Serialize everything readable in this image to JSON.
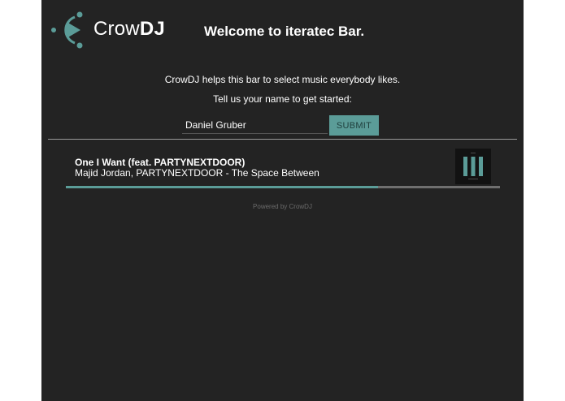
{
  "brand": {
    "name_regular": "Crow",
    "name_bold": "DJ"
  },
  "welcome": {
    "title": "Welcome to iteratec Bar.",
    "line1": "CrowDJ helps this bar to select music everybody likes.",
    "line2": "Tell us your name to get started:"
  },
  "form": {
    "name_value": "Daniel Gruber",
    "submit_label": "SUBMIT"
  },
  "now_playing": {
    "title": "One I Want (feat. PARTYNEXTDOOR)",
    "subtitle": "Majid Jordan, PARTYNEXTDOOR - The Space Between",
    "progress": 0.72
  },
  "footer": {
    "powered_by": "Powered by CrowDJ"
  },
  "colors": {
    "accent": "#5b9c98",
    "background": "#232323",
    "page": "#ffffff"
  }
}
